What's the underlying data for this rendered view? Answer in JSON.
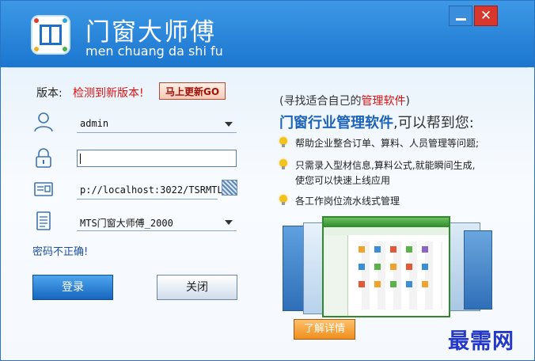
{
  "title": {
    "brand": "门窗大师傅",
    "subtitle": "men chuang da shi fu"
  },
  "window_controls": {
    "close_glyph": "✕"
  },
  "version": {
    "label": "版本:",
    "status": "检测到新版本!",
    "update_button": "马上更新GO"
  },
  "form": {
    "username": "admin",
    "password": "",
    "server": "p://localhost:3022/TSRMTLM",
    "database": "MTS门窗大师傅_2000"
  },
  "error_message": "密码不正确!",
  "buttons": {
    "login": "登录",
    "close": "关闭"
  },
  "promo": {
    "tagline_prefix": "(寻找适合自己的",
    "tagline_highlight": "管理软件",
    "tagline_suffix": ")",
    "headline_bold": "门窗行业管理软件",
    "headline_rest": ",可以帮到您:",
    "features": [
      "帮助企业整合订单、算料、人员管理等问题;",
      "只需录入型材信息,算料公式,就能瞬间生成,",
      "使您可以快速上线应用",
      "各工作岗位流水线式管理"
    ],
    "detail_button": "了解详情"
  },
  "watermark": "最需网",
  "colors": {
    "title_bar": "#2786d9",
    "error_text": "#1f4fa0",
    "warning_text": "#dd1111",
    "login_button": "#1d6fc7",
    "detail_button": "#ef8f1d"
  }
}
